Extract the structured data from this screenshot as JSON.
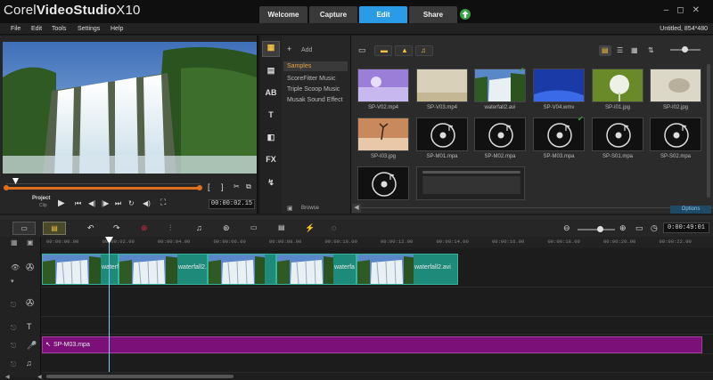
{
  "app": {
    "brand_prefix": "Corel",
    "brand_name": "VideoStudio",
    "brand_version": "X10"
  },
  "tabs": [
    {
      "label": "Welcome",
      "active": false
    },
    {
      "label": "Capture",
      "active": false
    },
    {
      "label": "Edit",
      "active": true
    },
    {
      "label": "Share",
      "active": false
    }
  ],
  "menu": [
    "File",
    "Edit",
    "Tools",
    "Settings",
    "Help"
  ],
  "project_info": "Untitled, 854*480",
  "player": {
    "mode_project": "Project",
    "mode_clip": "Clip",
    "timecode": "00:00:02.15",
    "bracket_in": "[",
    "bracket_out": "]"
  },
  "library": {
    "add_label": "Add",
    "browse_label": "Browse",
    "options_label": "Options",
    "folders": [
      "Samples",
      "ScoreFitter Music",
      "Triple Scoop Music",
      "Musak Sound Effect"
    ],
    "selected_folder": "Samples",
    "items": [
      {
        "name": "SP-V02.mp4",
        "kind": "video-purple"
      },
      {
        "name": "SP-V03.mp4",
        "kind": "video-beige"
      },
      {
        "name": "waterfall2.avi",
        "kind": "video-waterfall"
      },
      {
        "name": "SP-V04.wmv",
        "kind": "video-blue"
      },
      {
        "name": "SP-I01.jpg",
        "kind": "image-dandelion"
      },
      {
        "name": "SP-I02.jpg",
        "kind": "image-shell"
      },
      {
        "name": "SP-I03.jpg",
        "kind": "image-desert"
      },
      {
        "name": "SP-M01.mpa",
        "kind": "audio"
      },
      {
        "name": "SP-M02.mpa",
        "kind": "audio"
      },
      {
        "name": "SP-M03.mpa",
        "kind": "audio"
      },
      {
        "name": "SP-S01.mpa",
        "kind": "audio"
      },
      {
        "name": "SP-S02.mpa",
        "kind": "audio"
      },
      {
        "name": "",
        "kind": "audio"
      },
      {
        "name": "",
        "kind": "screen"
      }
    ]
  },
  "timeline": {
    "timecode": "0:00:49:01",
    "ruler": [
      "00:00:00.00",
      "00:00:02.00",
      "00:00:04.00",
      "00:00:06.00",
      "00:00:08.00",
      "00:00:10.00",
      "00:00:12.00",
      "00:00:14.00",
      "00:00:16.00",
      "00:00:18.00",
      "00:00:20.00",
      "00:00:22.00"
    ],
    "video_clips": [
      {
        "label": "waterfa"
      },
      {
        "label": "waterfall2."
      },
      {
        "label": ""
      },
      {
        "label": "waterfa"
      },
      {
        "label": "waterfall2.avi"
      }
    ],
    "music_clip": "SP-M03.mpa"
  },
  "colors": {
    "accent_tab": "#2a9be6",
    "scrubber": "#e07020",
    "video_clip": "#1e8a7a",
    "music_clip": "#7a1078"
  }
}
